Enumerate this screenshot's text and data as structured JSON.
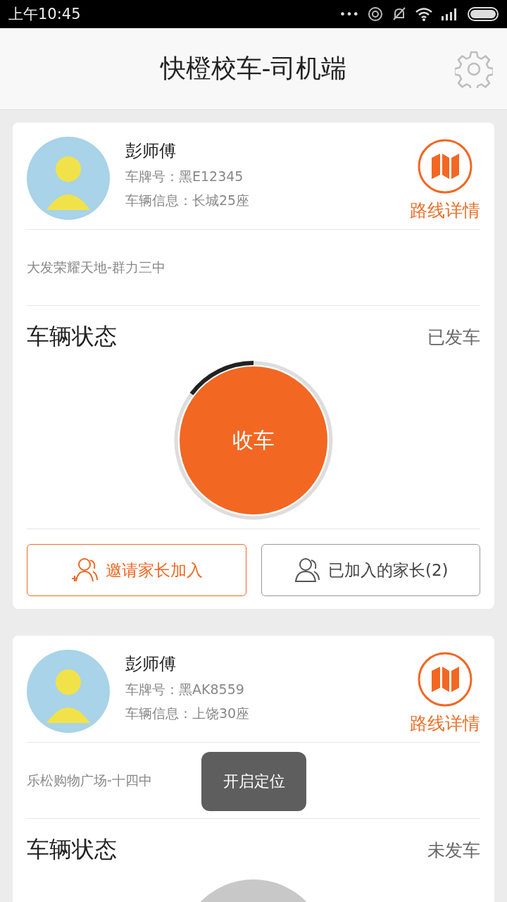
{
  "status_bar": {
    "time": "上午10:45",
    "dots": "•••"
  },
  "header": {
    "title": "快橙校车-司机端"
  },
  "cards": [
    {
      "driver": "彭师傅",
      "plate": "车牌号：黑E12345",
      "vehicle": "车辆信息：长城25座",
      "route_link": "路线详情",
      "route": "大发荣耀天地-群力三中",
      "status_label": "车辆状态",
      "status": "已发车",
      "departed": true,
      "action": "收车",
      "buttons": [
        {
          "kind": "invite",
          "label": "邀请家长加入"
        },
        {
          "kind": "joined",
          "label": "已加入的家长(2)"
        }
      ]
    },
    {
      "driver": "彭师傅",
      "plate": "车牌号：黑AK8559",
      "vehicle": "车辆信息：上饶30座",
      "route_link": "路线详情",
      "route": "乐松购物广场-十四中",
      "status_label": "车辆状态",
      "status": "未发车",
      "departed": false
    }
  ],
  "toast": "开启定位"
}
